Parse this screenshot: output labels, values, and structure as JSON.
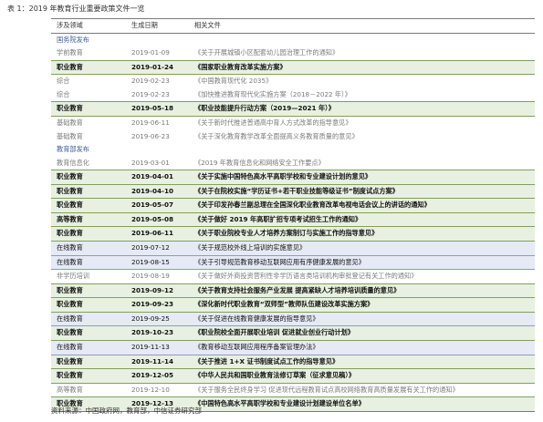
{
  "title": "表 1：2019 年教育行业重要政策文件一览",
  "headers": [
    "涉及领域",
    "生成日期",
    "相关文件"
  ],
  "sections": [
    {
      "label": "国务院发布",
      "rows": [
        {
          "field": "学前教育",
          "date": "2019-01-09",
          "doc": "《关于开展城镇小区配套幼儿园治理工作的通知》",
          "kind": "normal"
        },
        {
          "field": "职业教育",
          "date": "2019-01-24",
          "doc": "《国家职业教育改革实施方案》",
          "kind": "vocational"
        },
        {
          "field": "综合",
          "date": "2019-02-23",
          "doc": "《中国教育现代化 2035》",
          "kind": "normal"
        },
        {
          "field": "综合",
          "date": "2019-02-23",
          "doc": "《加快推进教育现代化实施方案（2018－2022 年）》",
          "kind": "normal"
        },
        {
          "field": "职业教育",
          "date": "2019-05-18",
          "doc": "《职业技能提升行动方案（2019—2021 年）》",
          "kind": "vocational"
        },
        {
          "field": "基础教育",
          "date": "2019-06-11",
          "doc": "《关于新时代推进普通高中育人方式改革的指导意见》",
          "kind": "normal"
        },
        {
          "field": "基础教育",
          "date": "2019-06-23",
          "doc": "《关于深化教育教学改革全面提高义务教育质量的意见》",
          "kind": "normal"
        }
      ]
    },
    {
      "label": "教育部发布",
      "rows": [
        {
          "field": "教育信息化",
          "date": "2019-03-01",
          "doc": "《2019 年教育信息化和网络安全工作要点》",
          "kind": "normal"
        },
        {
          "field": "职业教育",
          "date": "2019-04-01",
          "doc": "《关于实施中国特色高水平高职学校和专业建设计划的意见》",
          "kind": "vocational"
        },
        {
          "field": "职业教育",
          "date": "2019-04-10",
          "doc": "《关于在院校实施“学历证书+若干职业技能等级证书”制度试点方案》",
          "kind": "vocational"
        },
        {
          "field": "职业教育",
          "date": "2019-05-07",
          "doc": "《关于印发孙春兰副总理在全国深化职业教育改革电视电话会议上的讲话的通知》",
          "kind": "vocational"
        },
        {
          "field": "高等教育",
          "date": "2019-05-08",
          "doc": "《关于做好 2019 年高职扩招专项考试招生工作的通知》",
          "kind": "vocational"
        },
        {
          "field": "职业教育",
          "date": "2019-06-11",
          "doc": "《关于职业院校专业人才培养方案制订与实施工作的指导意见》",
          "kind": "vocational"
        },
        {
          "field": "在线教育",
          "date": "2019-07-12",
          "doc": "《关于规范校外线上培训的实施意见》",
          "kind": "online"
        },
        {
          "field": "在线教育",
          "date": "2019-08-15",
          "doc": "《关于引导规范教育移动互联网应用有序健康发展的意见》",
          "kind": "online"
        },
        {
          "field": "非学历培训",
          "date": "2019-08-19",
          "doc": "《关于做好外商投资营利性非学历语言类培训机构审批登记有关工作的通知》",
          "kind": "normal"
        },
        {
          "field": "职业教育",
          "date": "2019-09-12",
          "doc": "《关于教育支持社会服务产业发展  提高紧缺人才培养培训质量的意见》",
          "kind": "vocational"
        },
        {
          "field": "职业教育",
          "date": "2019-09-23",
          "doc": "《深化新时代职业教育“双师型”教师队伍建设改革实施方案》",
          "kind": "vocational"
        },
        {
          "field": "在线教育",
          "date": "2019-09-25",
          "doc": "《关于促进在线教育健康发展的指导意见》",
          "kind": "online"
        },
        {
          "field": "职业教育",
          "date": "2019-10-23",
          "doc": "《职业院校全面开展职业培训  促进就业创业行动计划》",
          "kind": "vocational"
        },
        {
          "field": "在线教育",
          "date": "2019-11-13",
          "doc": "《教育移动互联网应用程序备案管理办法》",
          "kind": "online"
        },
        {
          "field": "职业教育",
          "date": "2019-11-14",
          "doc": "《关于推进 1+X 证书制度试点工作的指导意见》",
          "kind": "vocational"
        },
        {
          "field": "职业教育",
          "date": "2019-12-05",
          "doc": "《中华人民共和国职业教育法修订草案（征求意见稿）》",
          "kind": "vocational"
        },
        {
          "field": "高等教育",
          "date": "2019-12-10",
          "doc": "《关于服务全民终身学习  促进现代远程教育试点高校网络教育高质量发展有关工作的通知》",
          "kind": "normal"
        },
        {
          "field": "职业教育",
          "date": "2019-12-13",
          "doc": "《中国特色高水平高职学校和专业建设计划建设单位名单》",
          "kind": "vocational"
        }
      ]
    }
  ],
  "source": "资料来源：中国政府网，教育部，中信证券研究部",
  "colors": {
    "vocational_bg": "#e8f1e1",
    "online_bg": "#e6eaf4",
    "section_text": "#3a5c9e",
    "normal_text": "#7a7a7a"
  }
}
